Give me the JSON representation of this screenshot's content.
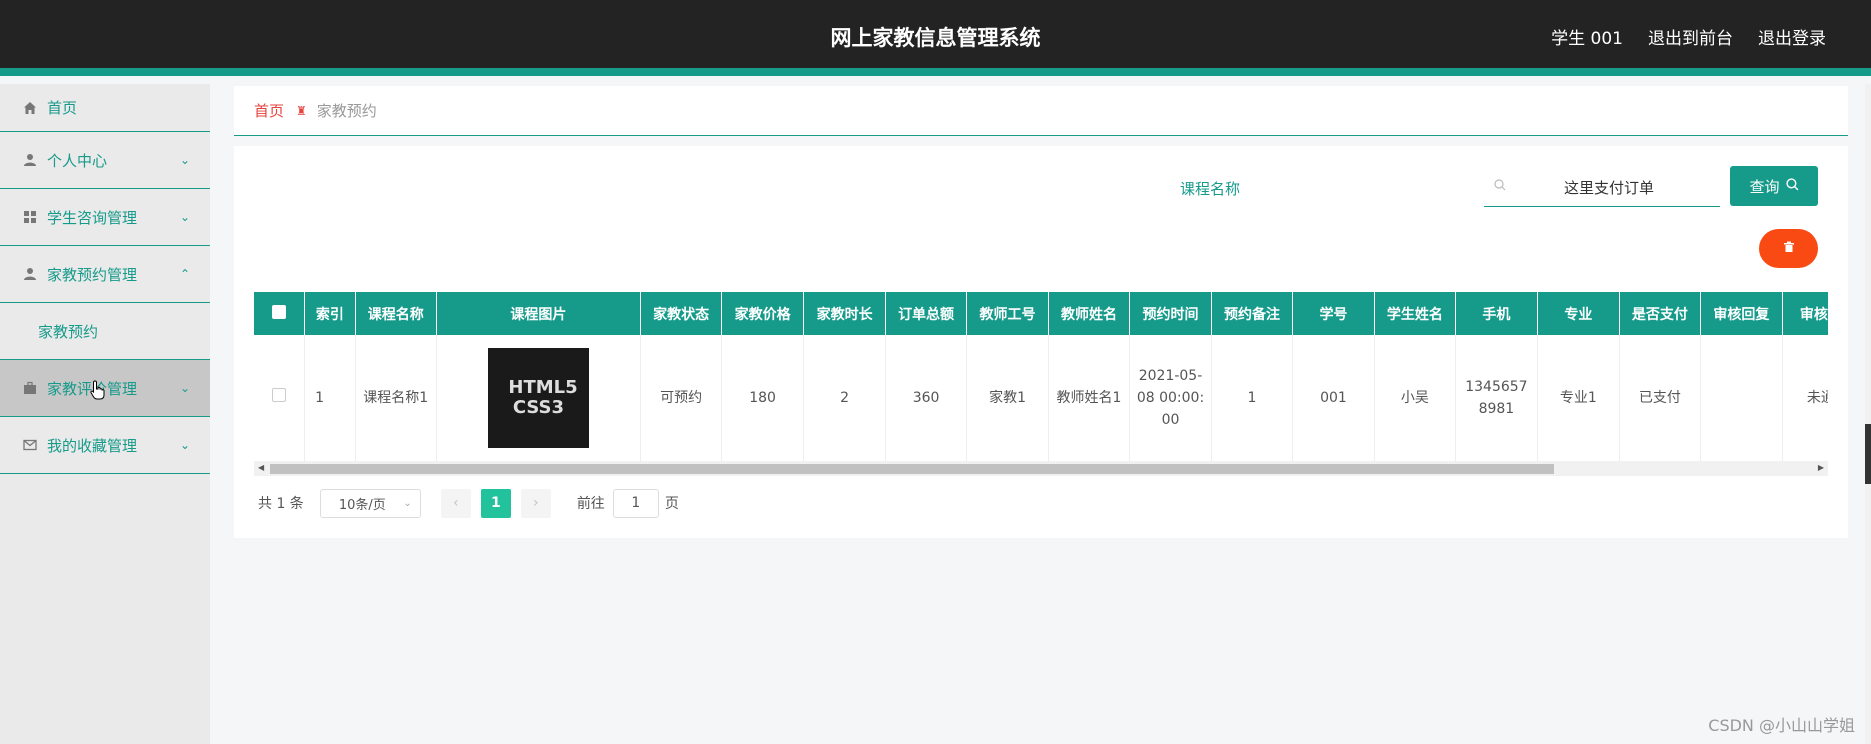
{
  "header": {
    "title": "网上家教信息管理系统",
    "user": "学生 001",
    "links": [
      "退出到前台",
      "退出登录"
    ]
  },
  "sidebar": {
    "items": [
      {
        "label": "首页",
        "icon": "home-icon"
      },
      {
        "label": "个人中心",
        "icon": "user-icon"
      },
      {
        "label": "学生咨询管理",
        "icon": "grid-icon"
      },
      {
        "label": "家教预约管理",
        "icon": "user-icon"
      },
      {
        "label": "家教预约",
        "icon": ""
      },
      {
        "label": "家教评价管理",
        "icon": "briefcase-icon"
      },
      {
        "label": "我的收藏管理",
        "icon": "mail-icon"
      }
    ]
  },
  "breadcrumb": {
    "home": "首页",
    "current": "家教预约"
  },
  "search": {
    "label": "课程名称",
    "value": "这里支付订单",
    "button": "查询"
  },
  "table": {
    "columns": [
      "索引",
      "课程名称",
      "课程图片",
      "家教状态",
      "家教价格",
      "家教时长",
      "订单总额",
      "教师工号",
      "教师姓名",
      "预约时间",
      "预约备注",
      "学号",
      "学生姓名",
      "手机",
      "专业",
      "是否支付",
      "审核回复",
      "审核状态"
    ],
    "rows": [
      {
        "index": "1",
        "course_name": "课程名称1",
        "image_text": "HTML5 CSS3",
        "status": "可预约",
        "price": "180",
        "duration": "2",
        "total": "360",
        "teacher_id": "家教1",
        "teacher_name": "教师姓名1",
        "time": "2021-05-08 00:00:00",
        "note": "1",
        "student_id": "001",
        "student_name": "小吴",
        "phone": "13456578981",
        "major": "专业1",
        "paid": "已支付",
        "reply": "",
        "audit": "未通过"
      }
    ]
  },
  "pager": {
    "total": "共 1 条",
    "page_size": "10条/页",
    "current": "1",
    "goto": "前往",
    "goto_value": "1",
    "page_unit": "页"
  },
  "watermark": "CSDN @小山山学姐",
  "colors": {
    "primary": "#169b8b",
    "danger": "#fa4a14",
    "header": "#232323"
  }
}
